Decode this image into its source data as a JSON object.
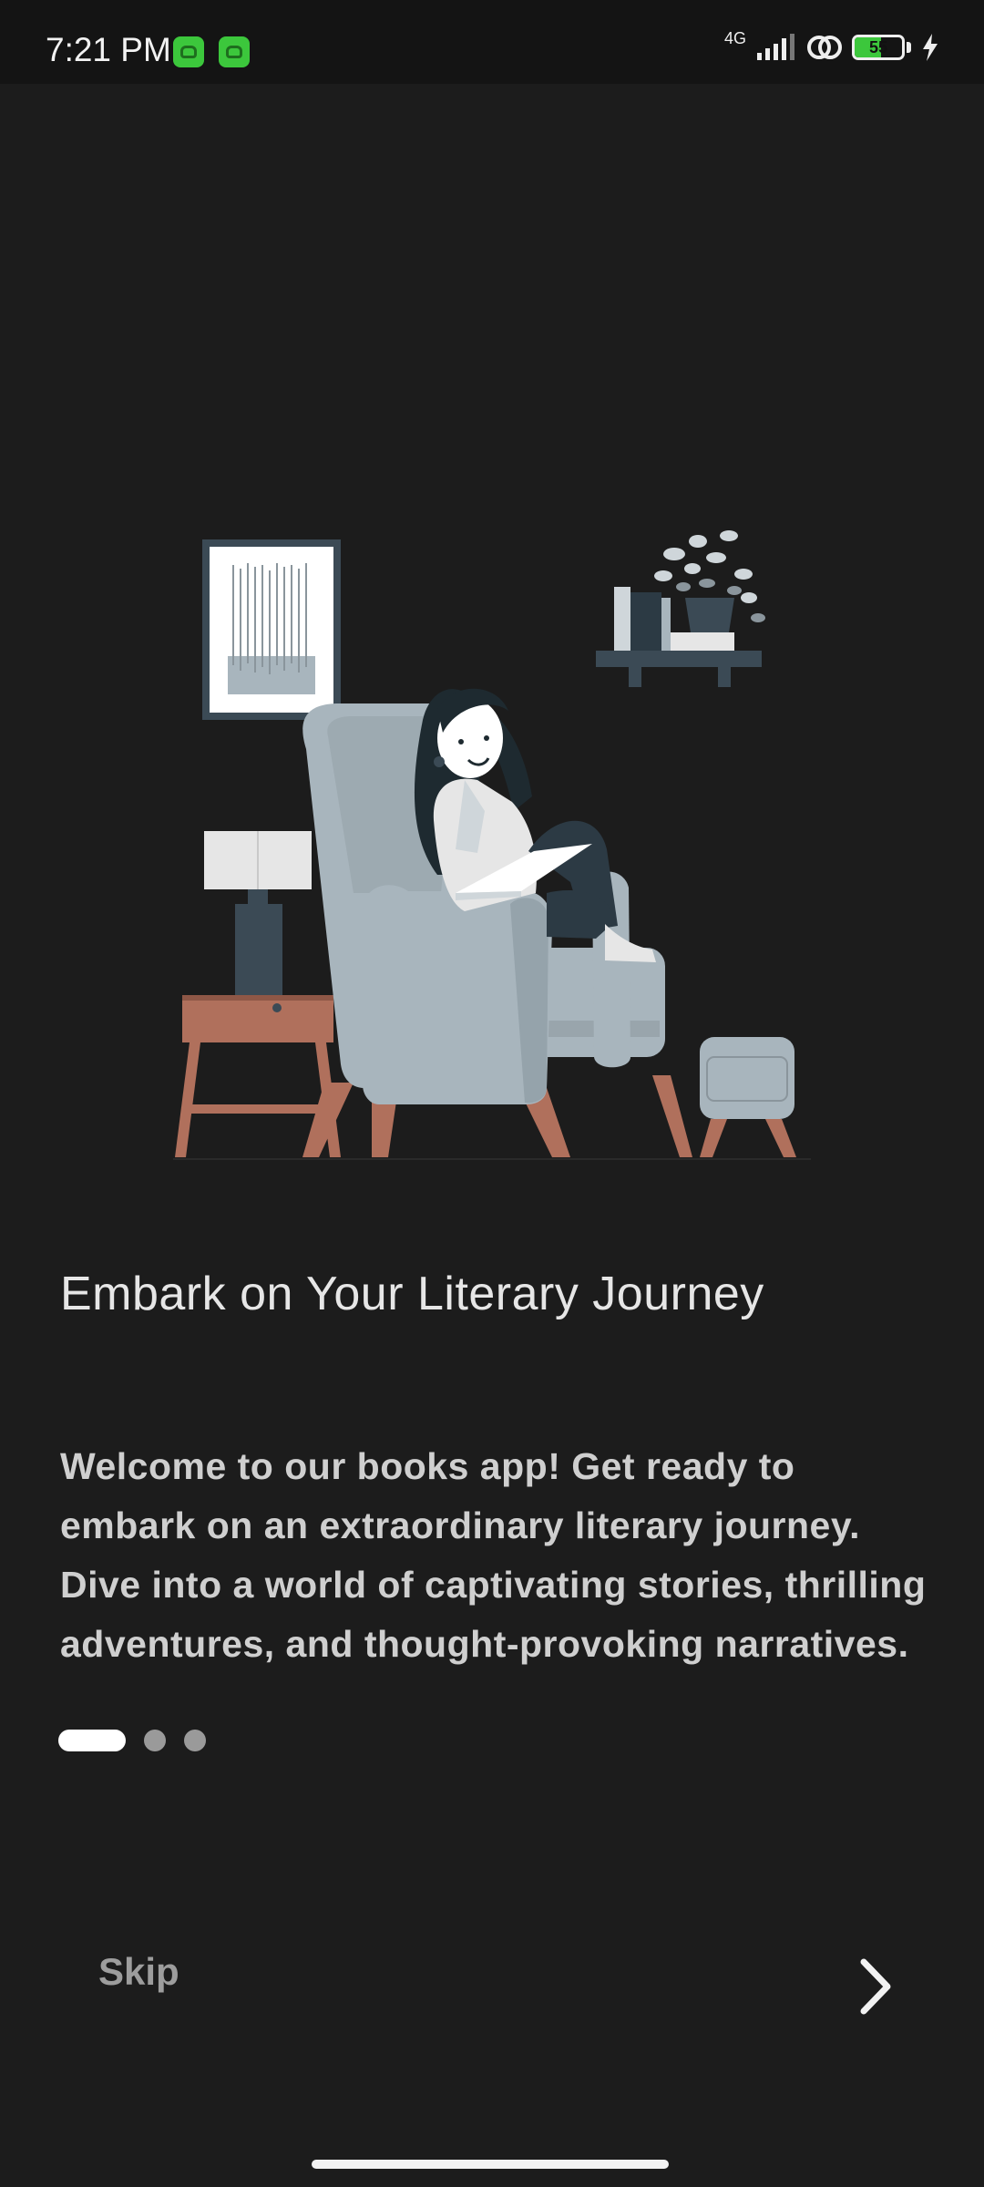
{
  "status_bar": {
    "time": "7:21 PM",
    "network": "4G",
    "battery": "55",
    "battery_level": 0.55,
    "accent_color": "#3cc73c"
  },
  "onboarding": {
    "title": "Embark on Your Literary Journey",
    "description": "Welcome to our books app! Get ready to embark on an extraordinary literary journey. Dive into a world of captivating stories, thrilling adventures, and thought-provoking narratives.",
    "page_index": 1,
    "page_count": 3
  },
  "footer": {
    "skip_label": "Skip",
    "next_icon": "chevron-right-icon"
  },
  "colors": {
    "background": "#1c1c1c",
    "chair": "#a8b5bd",
    "wood": "#b0705c",
    "dark_slate": "#3b4a55"
  }
}
